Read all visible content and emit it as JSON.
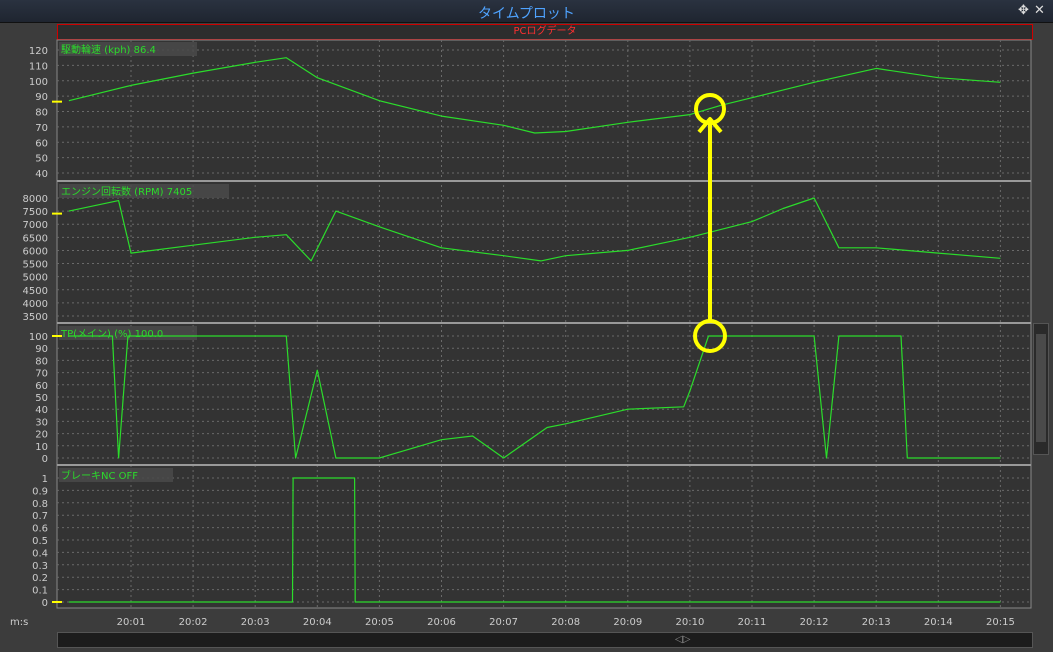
{
  "window": {
    "title": "タイムプロット",
    "move_icon": "move-icon",
    "close_icon": "close-icon"
  },
  "subheader": {
    "label": "PCログデータ"
  },
  "axis": {
    "x_unit_label": "m:s",
    "x_ticks": [
      "20:01",
      "20:02",
      "20:03",
      "20:04",
      "20:05",
      "20:06",
      "20:07",
      "20:08",
      "20:09",
      "20:10",
      "20:11",
      "20:12",
      "20:13",
      "20:14",
      "20:15"
    ]
  },
  "colors": {
    "trace": "#2bdc2b",
    "marker": "#ffff00",
    "grid": "#6a6a6a",
    "plot_bg": "#333333",
    "label": "#cccccc"
  },
  "annotation": {
    "type": "circled-arrow",
    "color": "#ffff00",
    "from_channel": "TP(メイン)",
    "to_channel": "駆動輪速"
  },
  "chart_data": [
    {
      "type": "line",
      "channel": "駆動輪速 (kph)",
      "title": "駆動輪速 (kph)",
      "readout": "86.4",
      "y_ticks": [
        "120",
        "110",
        "100",
        "90",
        "80",
        "70",
        "60",
        "50",
        "40"
      ],
      "ylim": [
        35,
        125
      ],
      "x": [
        "20:00",
        "20:01",
        "20:02",
        "20:03",
        "20:03.5",
        "20:04",
        "20:05",
        "20:06",
        "20:07",
        "20:07.5",
        "20:08",
        "20:09",
        "20:10",
        "20:10.5",
        "20:11",
        "20:12",
        "20:13",
        "20:14",
        "20:15"
      ],
      "values": [
        87,
        97,
        105,
        112,
        115,
        102,
        87,
        77,
        71,
        66,
        67,
        73,
        78,
        84,
        89,
        99,
        108,
        102,
        99
      ],
      "grid": true
    },
    {
      "type": "line",
      "channel": "エンジン回転数 (RPM)",
      "title": "エンジン回転数 (RPM)",
      "readout": "7405",
      "y_ticks": [
        "8000",
        "7500",
        "7000",
        "6500",
        "6000",
        "5500",
        "5000",
        "4500",
        "4000",
        "3500"
      ],
      "ylim": [
        3300,
        8200
      ],
      "x": [
        "20:00",
        "20:00.8",
        "20:01",
        "20:02",
        "20:03",
        "20:03.5",
        "20:03.9",
        "20:04.3",
        "20:05",
        "20:06",
        "20:07",
        "20:07.6",
        "20:08",
        "20:09",
        "20:10",
        "20:11",
        "20:11.5",
        "20:12",
        "20:12.4",
        "20:13",
        "20:14",
        "20:15"
      ],
      "values": [
        7500,
        7900,
        5900,
        6200,
        6500,
        6600,
        5600,
        7500,
        6900,
        6100,
        5800,
        5600,
        5800,
        6000,
        6500,
        7100,
        7600,
        8000,
        6100,
        6100,
        5900,
        5700
      ],
      "grid": true
    },
    {
      "type": "line",
      "channel": "TP(メイン) (%)",
      "title": "TP(メイン) (%)",
      "readout": "100.0",
      "y_ticks": [
        "100",
        "90",
        "80",
        "70",
        "60",
        "50",
        "40",
        "30",
        "20",
        "10",
        "0"
      ],
      "ylim": [
        0,
        105
      ],
      "x": [
        "20:00",
        "20:00.7",
        "20:00.8",
        "20:00.95",
        "20:01",
        "20:02",
        "20:03",
        "20:03.5",
        "20:03.65",
        "20:04",
        "20:04.3",
        "20:05",
        "20:06",
        "20:06.5",
        "20:07",
        "20:07.7",
        "20:08",
        "20:09",
        "20:09.9",
        "20:10",
        "20:10.3",
        "20:11",
        "20:12",
        "20:12.2",
        "20:12.4",
        "20:13",
        "20:13.4",
        "20:13.5",
        "20:14",
        "20:15"
      ],
      "values": [
        100,
        100,
        0,
        100,
        100,
        100,
        100,
        100,
        0,
        72,
        0,
        0,
        15,
        18,
        0,
        25,
        28,
        40,
        42,
        55,
        100,
        100,
        100,
        0,
        100,
        100,
        100,
        0,
        0,
        0
      ],
      "grid": true
    },
    {
      "type": "line",
      "channel": "ブレーキNC",
      "title": "ブレーキNC",
      "readout": "OFF",
      "y_ticks": [
        "1",
        "0.9",
        "0.8",
        "0.7",
        "0.6",
        "0.5",
        "0.4",
        "0.3",
        "0.2",
        "0.1",
        "0"
      ],
      "ylim": [
        0,
        1.05
      ],
      "x": [
        "20:00",
        "20:03.6",
        "20:03.61",
        "20:04.6",
        "20:04.61",
        "20:15"
      ],
      "values": [
        0,
        0,
        1,
        1,
        0,
        0
      ],
      "grid": true
    }
  ]
}
